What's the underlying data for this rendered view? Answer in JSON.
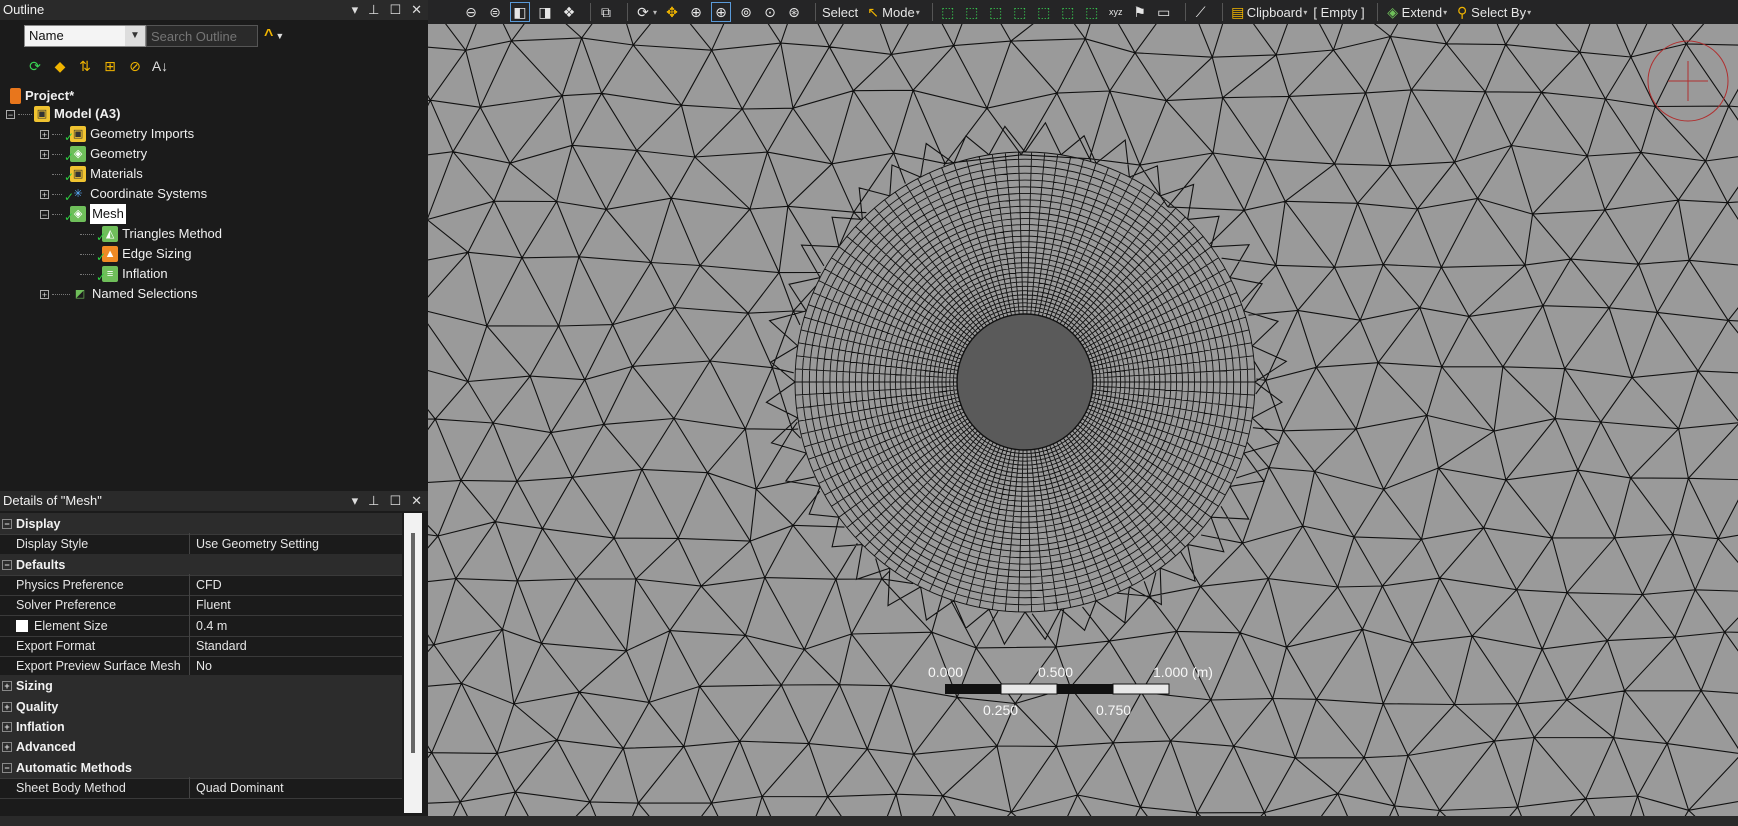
{
  "outline": {
    "title": "Outline",
    "filter_select": "Name",
    "search_placeholder": "Search Outline",
    "tree": {
      "project": "Project*",
      "model": "Model (A3)",
      "geometry_imports": "Geometry Imports",
      "geometry": "Geometry",
      "materials": "Materials",
      "coordinate_systems": "Coordinate Systems",
      "mesh": "Mesh",
      "triangles_method": "Triangles Method",
      "edge_sizing": "Edge Sizing",
      "inflation": "Inflation",
      "named_selections": "Named Selections"
    }
  },
  "details": {
    "title": "Details of \"Mesh\"",
    "rows": [
      {
        "type": "group",
        "label": "Display",
        "toggle": "−"
      },
      {
        "type": "prop",
        "name": "Display Style",
        "value": "Use Geometry Setting"
      },
      {
        "type": "group",
        "label": "Defaults",
        "toggle": "−"
      },
      {
        "type": "prop",
        "name": "Physics Preference",
        "value": "CFD"
      },
      {
        "type": "prop",
        "name": "Solver Preference",
        "value": "Fluent"
      },
      {
        "type": "prop",
        "name": "Element Size",
        "value": "0.4 m",
        "swatch": true
      },
      {
        "type": "prop",
        "name": "Export Format",
        "value": "Standard"
      },
      {
        "type": "prop",
        "name": "Export Preview Surface Mesh",
        "value": "No"
      },
      {
        "type": "group",
        "label": "Sizing",
        "toggle": "+"
      },
      {
        "type": "group",
        "label": "Quality",
        "toggle": "+"
      },
      {
        "type": "group",
        "label": "Inflation",
        "toggle": "+"
      },
      {
        "type": "group",
        "label": "Advanced",
        "toggle": "+"
      },
      {
        "type": "group",
        "label": "Automatic Methods",
        "toggle": "−"
      },
      {
        "type": "prop",
        "name": "Sheet Body Method",
        "value": "Quad Dominant"
      }
    ]
  },
  "toolbar": {
    "select": "Select",
    "mode": "Mode",
    "clipboard": "Clipboard",
    "empty": "[ Empty ]",
    "extend": "Extend",
    "select_by": "Select By"
  },
  "scale_bar": {
    "label_0": "0.000",
    "label_500": "0.500",
    "label_1000": "1.000 (m)",
    "label_250": "0.250",
    "label_750": "0.750"
  },
  "colors": {
    "viewport_bg": "#9a9a9a",
    "mesh_line": "#111111",
    "cylinder_fill": "#5a5a5a",
    "check_green": "#2ecc40",
    "accent_orange": "#f0b400"
  },
  "icons": {
    "project": "project-icon",
    "model": "model-icon",
    "refresh": "refresh-icon",
    "eraser": "eraser-icon",
    "sort": "sort-icon",
    "grid": "grid-icon",
    "link": "link-icon",
    "sort_az": "sort-az-icon"
  }
}
